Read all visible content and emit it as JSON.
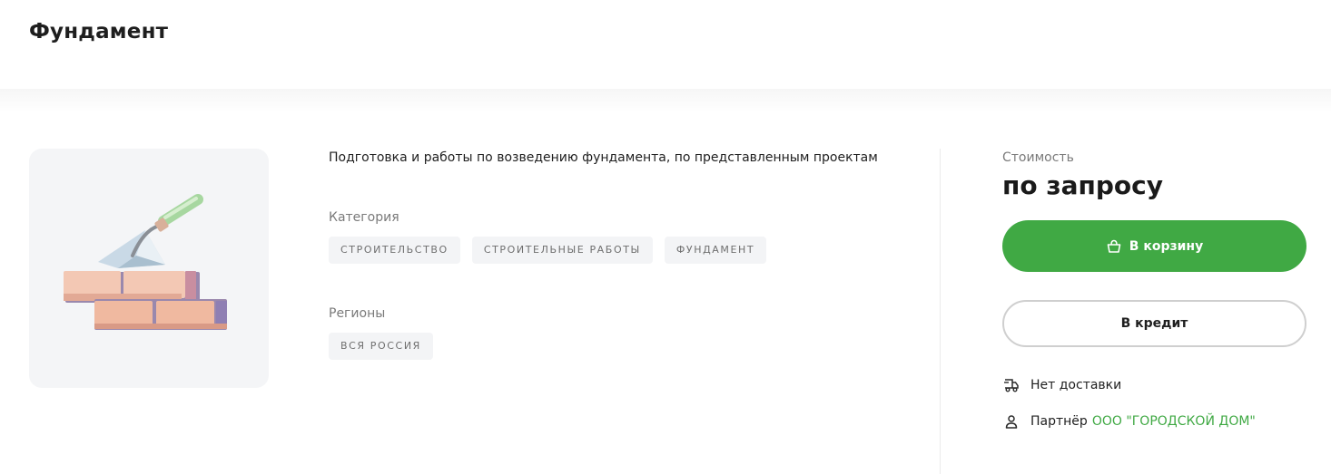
{
  "header": {
    "title": "Фундамент"
  },
  "product": {
    "description": "Подготовка и работы по возведению фундамента, по представленным проектам",
    "category_label": "Категория",
    "categories": [
      "СТРОИТЕЛЬСТВО",
      "СТРОИТЕЛЬНЫЕ РАБОТЫ",
      "ФУНДАМЕНТ"
    ],
    "regions_label": "Регионы",
    "regions": [
      "ВСЯ РОССИЯ"
    ],
    "image_icon": "bricks-trowel-icon"
  },
  "purchase": {
    "price_label": "Стоимость",
    "price_value": "по запросу",
    "cart_button": "В корзину",
    "credit_button": "В кредит",
    "delivery_text": "Нет доставки",
    "partner_label": "Партнёр",
    "partner_name": "ООО \"ГОРОДСКОЙ ДОМ\""
  },
  "colors": {
    "accent": "#40a944",
    "muted_text": "#7a7a7a",
    "tag_bg": "#f3f4f6"
  }
}
